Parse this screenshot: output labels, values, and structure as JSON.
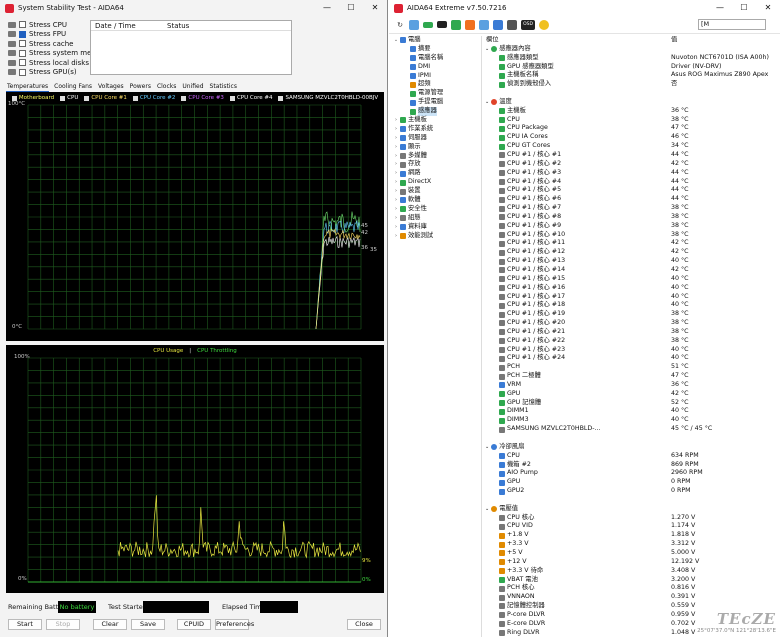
{
  "sst": {
    "title": "System Stability Test - AIDA64",
    "stress": [
      {
        "label": "Stress CPU",
        "checked": false
      },
      {
        "label": "Stress FPU",
        "checked": true
      },
      {
        "label": "Stress cache",
        "checked": false
      },
      {
        "label": "Stress system memory",
        "checked": false
      },
      {
        "label": "Stress local disks",
        "checked": false
      },
      {
        "label": "Stress GPU(s)",
        "checked": false
      }
    ],
    "status_cols": {
      "date": "Date / Time",
      "status": "Status"
    },
    "tabs": [
      "Temperatures",
      "Cooling Fans",
      "Voltages",
      "Powers",
      "Clocks",
      "Unified",
      "Statistics"
    ],
    "g1": {
      "legend": [
        "Motherboard",
        "CPU",
        "CPU Core #1",
        "CPU Core #2",
        "CPU Core #3",
        "CPU Core #4",
        "SAMSUNG MZVLC2T0HBLD-00BJV"
      ],
      "legend_colors": [
        "#ffff66",
        "#ffffff",
        "#ffe066",
        "#66ccff",
        "#cc66ff",
        "#ffffff",
        "#ffffff"
      ],
      "top": "100°C",
      "bottom": "0°C",
      "right_vals": [
        "45",
        "42",
        "36",
        "35"
      ]
    },
    "g2": {
      "legend_a": "CPU Usage",
      "legend_sep": "|",
      "legend_b": "CPU Throttling",
      "top": "100%",
      "bottom": "0%",
      "right_a": "9%",
      "right_b": "0%"
    },
    "info": {
      "battery_label": "Remaining Battery:",
      "battery_val": "No battery",
      "started_label": "Test Started:",
      "elapsed_label": "Elapsed Time:"
    },
    "buttons": {
      "start": "Start",
      "stop": "Stop",
      "clear": "Clear",
      "save": "Save",
      "cpuid": "CPUID",
      "prefs": "Preferences",
      "close": "Close"
    }
  },
  "aida": {
    "title": "AIDA64 Extreme v7.50.7216",
    "search": "[M",
    "toolbar_osd": "OSD",
    "tree": [
      {
        "label": "電腦",
        "lvl": 0,
        "exp": "⌄",
        "color": "#3a7bd5"
      },
      {
        "label": "摘要",
        "lvl": 1,
        "color": "#3a7bd5"
      },
      {
        "label": "電腦名稱",
        "lvl": 1,
        "color": "#3a7bd5"
      },
      {
        "label": "DMI",
        "lvl": 1,
        "color": "#3a7bd5"
      },
      {
        "label": "IPMI",
        "lvl": 1,
        "color": "#3a7bd5"
      },
      {
        "label": "超頻",
        "lvl": 1,
        "color": "#e08a00"
      },
      {
        "label": "電源管理",
        "lvl": 1,
        "color": "#2fa84f"
      },
      {
        "label": "手提電腦",
        "lvl": 1,
        "color": "#3a7bd5"
      },
      {
        "label": "感應器",
        "lvl": 1,
        "color": "#2fa84f",
        "sel": true
      },
      {
        "label": "主機板",
        "lvl": 0,
        "exp": "›",
        "color": "#2fa84f"
      },
      {
        "label": "作業系統",
        "lvl": 0,
        "exp": "›",
        "color": "#3a7bd5"
      },
      {
        "label": "伺服器",
        "lvl": 0,
        "exp": "›",
        "color": "#3a7bd5"
      },
      {
        "label": "顯示",
        "lvl": 0,
        "exp": "›",
        "color": "#3a7bd5"
      },
      {
        "label": "多媒體",
        "lvl": 0,
        "exp": "›",
        "color": "#777"
      },
      {
        "label": "存放",
        "lvl": 0,
        "exp": "›",
        "color": "#777"
      },
      {
        "label": "網路",
        "lvl": 0,
        "exp": "›",
        "color": "#3a7bd5"
      },
      {
        "label": "DirectX",
        "lvl": 0,
        "exp": "›",
        "color": "#2fa84f"
      },
      {
        "label": "裝置",
        "lvl": 0,
        "exp": "›",
        "color": "#777"
      },
      {
        "label": "軟體",
        "lvl": 0,
        "exp": "›",
        "color": "#3a7bd5"
      },
      {
        "label": "安全性",
        "lvl": 0,
        "exp": "›",
        "color": "#2fa84f"
      },
      {
        "label": "組態",
        "lvl": 0,
        "exp": "›",
        "color": "#777"
      },
      {
        "label": "資料庫",
        "lvl": 0,
        "exp": "›",
        "color": "#3a7bd5"
      },
      {
        "label": "效能測試",
        "lvl": 0,
        "exp": "›",
        "color": "#e08a00"
      }
    ],
    "cols": {
      "field": "欄位",
      "value": "值"
    },
    "rows": [
      {
        "sec": true,
        "f": "感應器內容",
        "v": "",
        "c": "#2fa84f"
      },
      {
        "f": "感應器類型",
        "v": "Nuvoton NCT6701D  (ISA A00h)",
        "c": "#2fa84f"
      },
      {
        "f": "GPU 感應器類型",
        "v": "Driver  (NV-DRV)",
        "c": "#2fa84f"
      },
      {
        "f": "主機板名稱",
        "v": "Asus ROG Maximus Z890 Apex",
        "c": "#2fa84f"
      },
      {
        "f": "偵測到機殼侵入",
        "v": "否",
        "c": "#2fa84f"
      },
      {
        "f": "",
        "v": ""
      },
      {
        "sec": true,
        "f": "溫度",
        "v": "",
        "c": "#e0442a"
      },
      {
        "f": "主機板",
        "v": "36 °C",
        "c": "#2fa84f"
      },
      {
        "f": "CPU",
        "v": "38 °C",
        "c": "#2fa84f"
      },
      {
        "f": "CPU Package",
        "v": "47 °C",
        "c": "#2fa84f"
      },
      {
        "f": "CPU IA Cores",
        "v": "46 °C",
        "c": "#2fa84f"
      },
      {
        "f": "CPU GT Cores",
        "v": "34 °C",
        "c": "#2fa84f"
      },
      {
        "f": "CPU #1 / 核心 #1",
        "v": "44 °C",
        "c": "#777"
      },
      {
        "f": "CPU #1 / 核心 #2",
        "v": "42 °C",
        "c": "#777"
      },
      {
        "f": "CPU #1 / 核心 #3",
        "v": "44 °C",
        "c": "#777"
      },
      {
        "f": "CPU #1 / 核心 #4",
        "v": "44 °C",
        "c": "#777"
      },
      {
        "f": "CPU #1 / 核心 #5",
        "v": "44 °C",
        "c": "#777"
      },
      {
        "f": "CPU #1 / 核心 #6",
        "v": "44 °C",
        "c": "#777"
      },
      {
        "f": "CPU #1 / 核心 #7",
        "v": "38 °C",
        "c": "#777"
      },
      {
        "f": "CPU #1 / 核心 #8",
        "v": "38 °C",
        "c": "#777"
      },
      {
        "f": "CPU #1 / 核心 #9",
        "v": "38 °C",
        "c": "#777"
      },
      {
        "f": "CPU #1 / 核心 #10",
        "v": "38 °C",
        "c": "#777"
      },
      {
        "f": "CPU #1 / 核心 #11",
        "v": "42 °C",
        "c": "#777"
      },
      {
        "f": "CPU #1 / 核心 #12",
        "v": "42 °C",
        "c": "#777"
      },
      {
        "f": "CPU #1 / 核心 #13",
        "v": "40 °C",
        "c": "#777"
      },
      {
        "f": "CPU #1 / 核心 #14",
        "v": "42 °C",
        "c": "#777"
      },
      {
        "f": "CPU #1 / 核心 #15",
        "v": "40 °C",
        "c": "#777"
      },
      {
        "f": "CPU #1 / 核心 #16",
        "v": "40 °C",
        "c": "#777"
      },
      {
        "f": "CPU #1 / 核心 #17",
        "v": "40 °C",
        "c": "#777"
      },
      {
        "f": "CPU #1 / 核心 #18",
        "v": "40 °C",
        "c": "#777"
      },
      {
        "f": "CPU #1 / 核心 #19",
        "v": "38 °C",
        "c": "#777"
      },
      {
        "f": "CPU #1 / 核心 #20",
        "v": "38 °C",
        "c": "#777"
      },
      {
        "f": "CPU #1 / 核心 #21",
        "v": "38 °C",
        "c": "#777"
      },
      {
        "f": "CPU #1 / 核心 #22",
        "v": "38 °C",
        "c": "#777"
      },
      {
        "f": "CPU #1 / 核心 #23",
        "v": "40 °C",
        "c": "#777"
      },
      {
        "f": "CPU #1 / 核心 #24",
        "v": "40 °C",
        "c": "#777"
      },
      {
        "f": "PCH",
        "v": "51 °C",
        "c": "#777"
      },
      {
        "f": "PCH 二極體",
        "v": "47 °C",
        "c": "#777"
      },
      {
        "f": "VRM",
        "v": "36 °C",
        "c": "#3a7bd5"
      },
      {
        "f": "GPU",
        "v": "42 °C",
        "c": "#2fa84f"
      },
      {
        "f": "GPU 記憶體",
        "v": "52 °C",
        "c": "#2fa84f"
      },
      {
        "f": "DIMM1",
        "v": "40 °C",
        "c": "#2fa84f"
      },
      {
        "f": "DIMM3",
        "v": "40 °C",
        "c": "#2fa84f"
      },
      {
        "f": "SAMSUNG MZVLC2T0HBLD-...",
        "v": "45 °C / 45 °C",
        "c": "#777"
      },
      {
        "f": "",
        "v": ""
      },
      {
        "sec": true,
        "f": "冷卻風扇",
        "v": "",
        "c": "#3a7bd5"
      },
      {
        "f": "CPU",
        "v": "634 RPM",
        "c": "#3a7bd5"
      },
      {
        "f": "機箱 #2",
        "v": "869 RPM",
        "c": "#3a7bd5"
      },
      {
        "f": "AIO Pump",
        "v": "2960 RPM",
        "c": "#3a7bd5"
      },
      {
        "f": "GPU",
        "v": "0 RPM",
        "c": "#3a7bd5"
      },
      {
        "f": "GPU2",
        "v": "0 RPM",
        "c": "#3a7bd5"
      },
      {
        "f": "",
        "v": ""
      },
      {
        "sec": true,
        "f": "電壓值",
        "v": "",
        "c": "#e08a00"
      },
      {
        "f": "CPU 核心",
        "v": "1.270 V",
        "c": "#777"
      },
      {
        "f": "CPU VID",
        "v": "1.174 V",
        "c": "#777"
      },
      {
        "f": "+1.8 V",
        "v": "1.818 V",
        "c": "#e08a00"
      },
      {
        "f": "+3.3 V",
        "v": "3.312 V",
        "c": "#e08a00"
      },
      {
        "f": "+5 V",
        "v": "5.000 V",
        "c": "#e08a00"
      },
      {
        "f": "+12 V",
        "v": "12.192 V",
        "c": "#e08a00"
      },
      {
        "f": "+3.3 V 待命",
        "v": "3.408 V",
        "c": "#e08a00"
      },
      {
        "f": "VBAT 電池",
        "v": "3.200 V",
        "c": "#2fa84f"
      },
      {
        "f": "PCH 核心",
        "v": "0.816 V",
        "c": "#777"
      },
      {
        "f": "VNNAON",
        "v": "0.391 V",
        "c": "#777"
      },
      {
        "f": "記憶體控制器",
        "v": "0.559 V",
        "c": "#777"
      },
      {
        "f": "P-core DLVR",
        "v": "0.959 V",
        "c": "#777"
      },
      {
        "f": "E-core DLVR",
        "v": "0.702 V",
        "c": "#777"
      },
      {
        "f": "Ring DLVR",
        "v": "1.048 V",
        "c": "#777"
      }
    ],
    "watermark_logo": "TEcZE",
    "watermark_coords": "25°07'37.0\"N 121°28'13.6\"E"
  }
}
